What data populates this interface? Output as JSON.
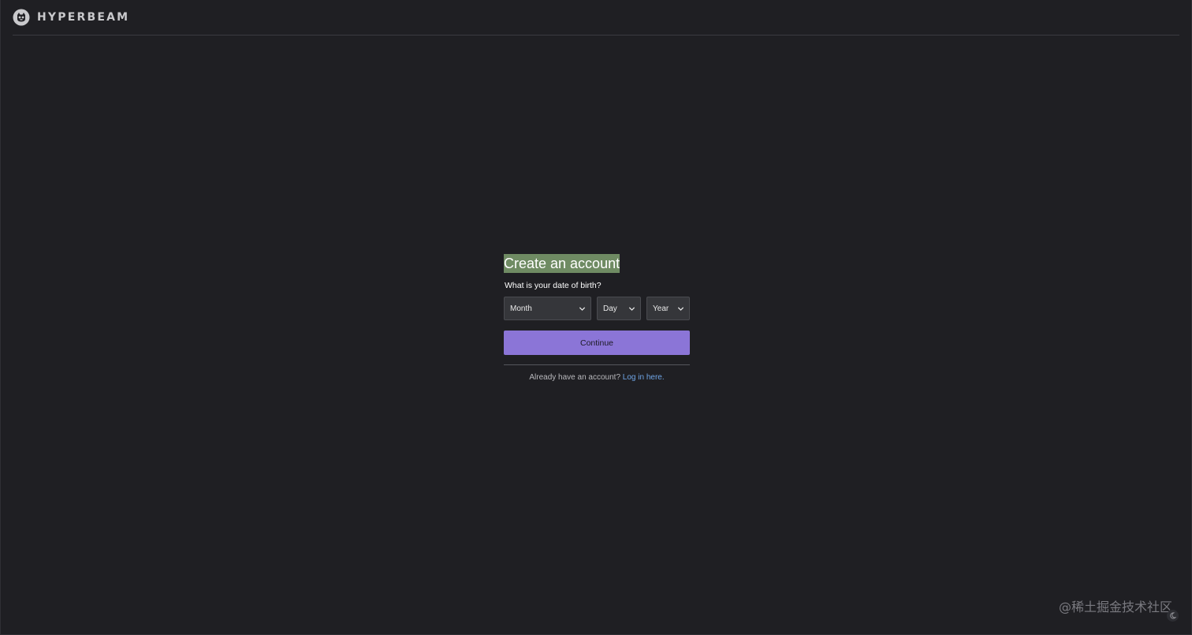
{
  "header": {
    "logo_icon": "hyperbeam-logo-icon",
    "brand": "HYPERBEAM"
  },
  "form": {
    "title": "Create an account",
    "question": "What is your date of birth?",
    "month_placeholder": "Month",
    "day_placeholder": "Day",
    "year_placeholder": "Year",
    "continue_label": "Continue",
    "login_prompt": "Already have an account?",
    "login_link": "Log in here."
  },
  "footer": {
    "watermark": "@稀土掘金技术社区",
    "theme_toggle_icon": "moon-icon"
  },
  "colors": {
    "background": "#1f1f23",
    "accent": "#8b75d7",
    "link": "#6fa5e6",
    "title_highlight": "#6f8b63"
  }
}
